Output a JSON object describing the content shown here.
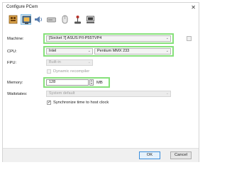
{
  "window": {
    "title": "Configure PCem"
  },
  "toolbar": [
    {
      "name": "machine-tab-icon"
    },
    {
      "name": "display-tab-icon"
    },
    {
      "name": "sound-tab-icon"
    },
    {
      "name": "drives-tab-icon"
    },
    {
      "name": "mouse-tab-icon"
    },
    {
      "name": "joystick-tab-icon"
    },
    {
      "name": "peripherals-tab-icon"
    }
  ],
  "fields": {
    "machine": {
      "label": "Machine:",
      "value": "[Socket 7] ASUS P/I-P55TVP4"
    },
    "cpu": {
      "label": "CPU:",
      "manufacturer": "Intel",
      "model": "Pentium MMX 233"
    },
    "fpu": {
      "label": "FPU:",
      "value": "Built-in"
    },
    "dynarec": {
      "label": "Dynamic recompiler"
    },
    "memory": {
      "label": "Memory:",
      "value": "128",
      "unit": "MB"
    },
    "waitstates": {
      "label": "Waitstates:",
      "value": "System default"
    },
    "sync": {
      "label": "Synchronize time to host clock"
    }
  },
  "buttons": {
    "ok": "OK",
    "cancel": "Cancel"
  },
  "colors": {
    "highlight": "#86e07a",
    "accent": "#3c8fdc"
  }
}
